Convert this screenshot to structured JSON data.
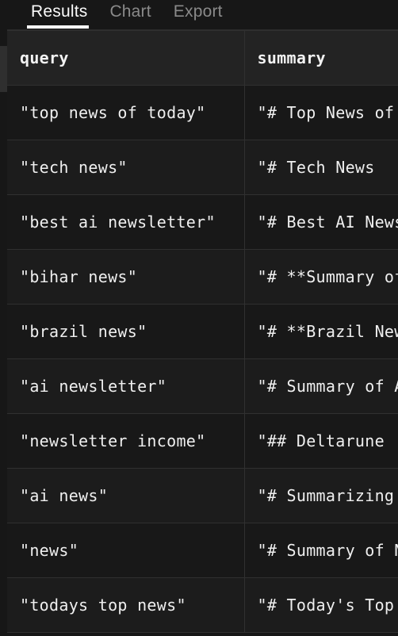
{
  "tabs": [
    {
      "label": "Results",
      "active": true
    },
    {
      "label": "Chart",
      "active": false
    },
    {
      "label": "Export",
      "active": false
    }
  ],
  "table": {
    "columns": [
      {
        "key": "query",
        "label": "query"
      },
      {
        "key": "summary",
        "label": "summary"
      }
    ],
    "rows": [
      {
        "query": "\"top news of today\"",
        "summary": "\"# Top News of Today"
      },
      {
        "query": "\"tech news\"",
        "summary": "\"# Tech News"
      },
      {
        "query": "\"best ai newsletter\"",
        "summary": "\"# Best AI Newsletter"
      },
      {
        "query": "\"bihar news\"",
        "summary": "\"# **Summary of Bihar News"
      },
      {
        "query": "\"brazil news\"",
        "summary": "\"# **Brazil News"
      },
      {
        "query": "\"ai newsletter\"",
        "summary": "\"# Summary of AI Newsletter"
      },
      {
        "query": "\"newsletter income\"",
        "summary": "\"## Deltarune"
      },
      {
        "query": "\"ai news\"",
        "summary": "\"# Summarizing AI News"
      },
      {
        "query": "\"news\"",
        "summary": "\"# Summary of News"
      },
      {
        "query": "\"todays top news\"",
        "summary": "\"# Today's Top News"
      }
    ]
  },
  "colors": {
    "background": "#171717",
    "row_odd": "#181818",
    "row_even": "#1c1c1c",
    "header_bg": "#232323",
    "border": "#303030",
    "text": "#efefef",
    "tab_active": "#ffffff",
    "tab_inactive": "#8a8a8a",
    "scrollbar_thumb": "#2f2f2f"
  },
  "scrollbar": {
    "orientation": "vertical",
    "position": "left"
  }
}
